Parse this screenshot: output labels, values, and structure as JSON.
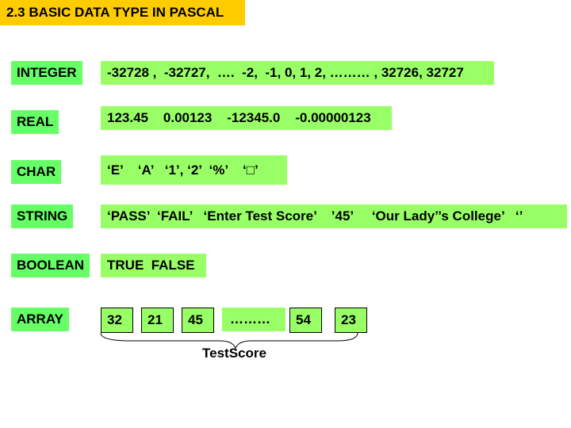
{
  "title": "2.3 BASIC DATA TYPE IN PASCAL",
  "rows": [
    {
      "label": "INTEGER",
      "value": "-32728 ,  -32727,  ….  -2,  -1, 0, 1, 2, ……… , 32726, 32727"
    },
    {
      "label": "REAL",
      "value": "123.45    0.00123    -12345.0    -0.00000123"
    },
    {
      "label": "CHAR",
      "value": "‘E’    ‘A’   ‘1’, ‘2’  ‘%’    ‘□’"
    },
    {
      "label": "STRING",
      "value": "‘PASS’  ‘FAIL’   ‘Enter Test Score’    ’45’     ‘Our Lady’’s College’   ‘’"
    },
    {
      "label": "BOOLEAN",
      "value": "TRUE  FALSE"
    },
    {
      "label": "ARRAY"
    }
  ],
  "array": {
    "cells": [
      "32",
      "21",
      "45",
      "………",
      "54",
      "23"
    ],
    "name": "TestScore"
  },
  "colors": {
    "title_bg": "#ffcc00",
    "label_bg": "#66ff66",
    "value_bg": "#99ff66"
  }
}
